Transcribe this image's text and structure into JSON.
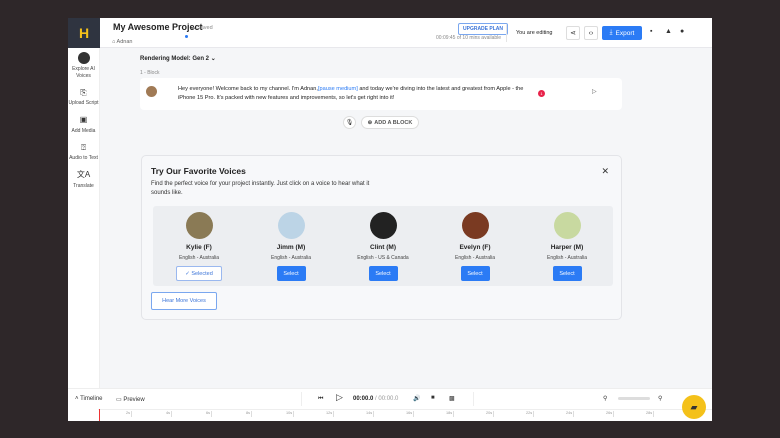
{
  "header": {
    "logo": "H",
    "project_title": "My Awesome Project",
    "saved": "Saved",
    "breadcrumb": "Adnan",
    "upgrade": "UPGRADE PLAN",
    "minutes": "00:09:45 of 10 mins available",
    "editing": "You are editing",
    "export": "Export"
  },
  "sidebar": {
    "items": [
      {
        "label": "Explore AI Voices"
      },
      {
        "label": "Upload Script"
      },
      {
        "label": "Add Media"
      },
      {
        "label": "Audio to Text"
      },
      {
        "label": "Translate"
      }
    ]
  },
  "editor": {
    "model": "Rendering Model: Gen 2",
    "block_label": "1 -  Block",
    "text_before": "Hey everyone! Welcome back to my channel. I'm Adnan,",
    "pause_tag": "[pause medium]",
    "text_after": " and today we're diving into the latest and greatest from Apple - the iPhone 15 Pro. It's packed with new features and improvements, so let's get right into it!",
    "badge": "1",
    "add_block": "ADD A BLOCK"
  },
  "voices_card": {
    "title": "Try Our Favorite Voices",
    "description": "Find the perfect voice for your project instantly. Just click on a voice to hear what it sounds like.",
    "hear_more": "Hear More Voices",
    "voices": [
      {
        "name": "Kylie (F)",
        "lang": "English - Australia",
        "button": "Selected",
        "selected": true,
        "color": "#8a7a55"
      },
      {
        "name": "Jimm (M)",
        "lang": "English - Australia",
        "button": "Select",
        "selected": false,
        "color": "#bcd4e6"
      },
      {
        "name": "Clint (M)",
        "lang": "English - US & Canada",
        "button": "Select",
        "selected": false,
        "color": "#222222"
      },
      {
        "name": "Evelyn (F)",
        "lang": "English - Australia",
        "button": "Select",
        "selected": false,
        "color": "#7a3a22"
      },
      {
        "name": "Harper (M)",
        "lang": "English - Australia",
        "button": "Select",
        "selected": false,
        "color": "#c8d9a0"
      }
    ]
  },
  "timeline": {
    "timeline": "Timeline",
    "preview": "Preview",
    "current": "00:00.0",
    "total": " / 00:00.0",
    "ticks": [
      "2s",
      "4s",
      "6s",
      "8s",
      "10s",
      "12s",
      "14s",
      "16s",
      "18s",
      "20s",
      "22s",
      "24s",
      "26s",
      "28s"
    ]
  },
  "colors": {
    "accent": "#2b7bf5",
    "brand": "#f4c11a"
  }
}
